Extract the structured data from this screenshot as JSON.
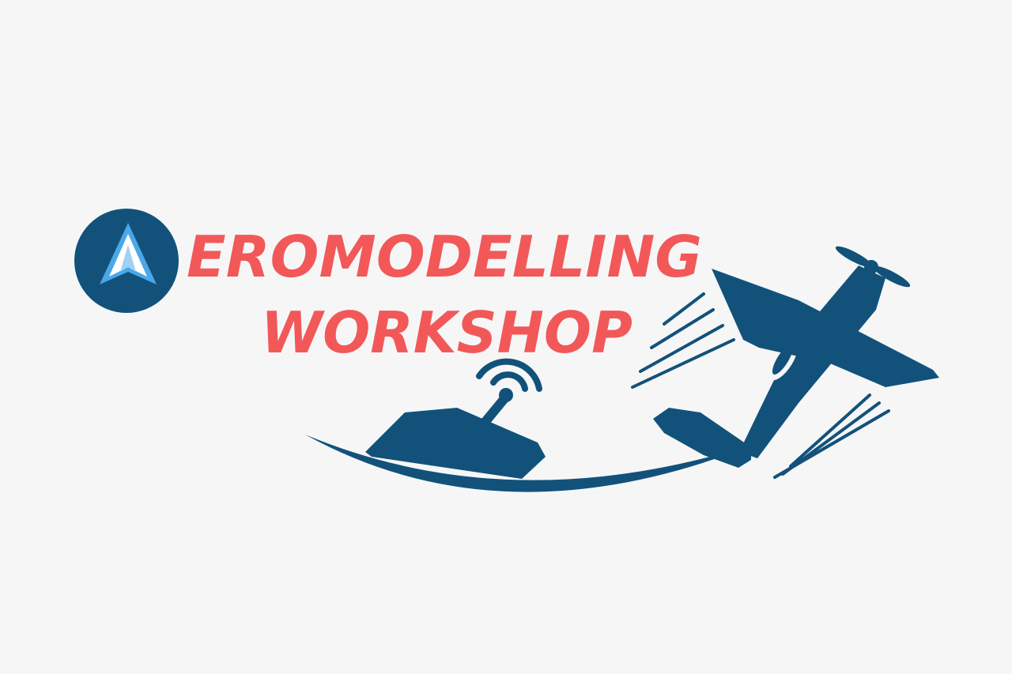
{
  "logo": {
    "line1": "EROMODELLING",
    "line2": "WORKSHOP",
    "emblem_icon": "arrow-up-icon",
    "airplane_icon": "airplane-icon",
    "remote_icon": "radio-transmitter-icon",
    "colors": {
      "background": "#f6f6f7",
      "primary_blue": "#12527a",
      "accent_red": "#f25858",
      "arrow_light": "#4aa8e8",
      "arrow_white": "#ffffff"
    }
  }
}
